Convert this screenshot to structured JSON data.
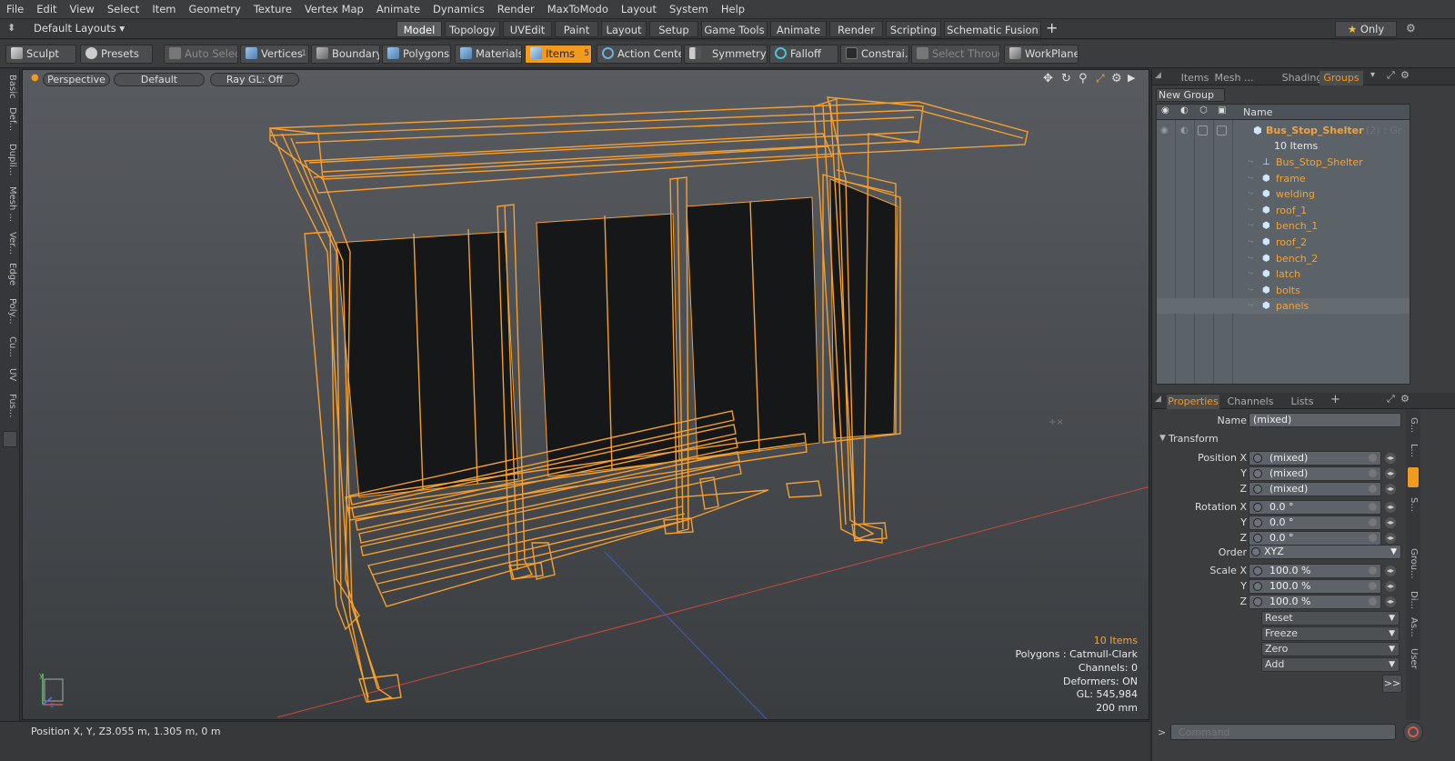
{
  "menu": [
    "File",
    "Edit",
    "View",
    "Select",
    "Item",
    "Geometry",
    "Texture",
    "Vertex Map",
    "Animate",
    "Dynamics",
    "Render",
    "MaxToModo",
    "Layout",
    "System",
    "Help"
  ],
  "layout_menu": "Default Layouts",
  "layout_tabs": [
    "Model",
    "Topology",
    "UVEdit",
    "Paint",
    "Layout",
    "Setup",
    "Game Tools",
    "Animate",
    "Render",
    "Scripting",
    "Schematic Fusion"
  ],
  "only_label": "Only",
  "toolbar": {
    "sculpt": "Sculpt",
    "presets": "Presets",
    "auto_select": "Auto Select",
    "vertices": "Vertices",
    "vertices_count": "1",
    "boundary": "Boundary",
    "polygons": "Polygons",
    "materials": "Materials",
    "items": "Items",
    "items_count": "5",
    "action_center": "Action Center",
    "symmetry": "Symmetry",
    "falloff": "Falloff",
    "constraints": "Constrai...",
    "select_through": "Select Through",
    "workplane": "WorkPlane"
  },
  "left_tabs": [
    "Basic",
    "Def...",
    "Dupli...",
    "Mesh ...",
    "Ver...",
    "Edge",
    "Poly...",
    "Cu...",
    "UV",
    "Fus..."
  ],
  "viewport": {
    "view": "Perspective",
    "shading": "Default",
    "raygl": "Ray GL: Off",
    "info": {
      "items": "10 Items",
      "polygons": "Polygons : Catmull-Clark",
      "channels": "Channels: 0",
      "deformers": "Deformers: ON",
      "gl": "GL: 545,984",
      "unit": "200 mm"
    }
  },
  "status": {
    "position_label": "Position X, Y, Z:",
    "position_value": "3.055 m, 1.305 m, 0 m"
  },
  "right_top_tabs": [
    "Items",
    "Mesh ...",
    "Shading",
    "Groups"
  ],
  "new_group": "New Group",
  "outliner": {
    "header": "Name",
    "root": "Bus_Stop_Shelter",
    "root_suffix": "(2) : Gr",
    "count": "10 Items",
    "children": [
      "Bus_Stop_Shelter",
      "frame",
      "welding",
      "roof_1",
      "bench_1",
      "roof_2",
      "bench_2",
      "latch",
      "bolts",
      "panels"
    ]
  },
  "props_tabs": [
    "Properties",
    "Channels",
    "Lists"
  ],
  "properties": {
    "name_label": "Name",
    "name_value": "(mixed)",
    "transform": "Transform",
    "position_x_label": "Position X",
    "y_label": "Y",
    "z_label": "Z",
    "rotation_x_label": "Rotation X",
    "order_label": "Order",
    "scale_x_label": "Scale X",
    "pos_x": "(mixed)",
    "pos_y": "(mixed)",
    "pos_z": "(mixed)",
    "rot_x": "0.0 °",
    "rot_y": "0.0 °",
    "rot_z": "0.0 °",
    "order": "XYZ",
    "scale_x": "100.0 %",
    "scale_y": "100.0 %",
    "scale_z": "100.0 %",
    "reset": "Reset",
    "freeze": "Freeze",
    "zero": "Zero",
    "add": "Add",
    "more": ">>"
  },
  "right_vtabs": [
    "G...",
    "L...",
    "S...",
    "Grou...",
    "Di...",
    "As...",
    "User"
  ],
  "command_placeholder": "Command",
  "colors": {
    "accent": "#f29a1e",
    "wire": "#f5a030"
  }
}
